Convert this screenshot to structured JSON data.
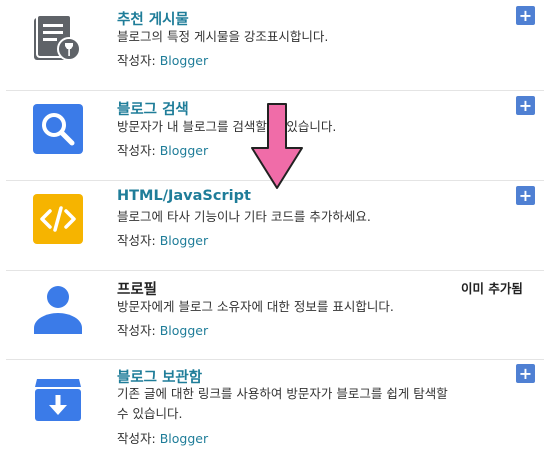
{
  "gadgets": [
    {
      "title": "추천 게시물",
      "description": "블로그의 특정 게시물을 강조표시합니다.",
      "author_label": "작성자:",
      "author": "Blogger",
      "icon": "featured-post-icon",
      "action": "+"
    },
    {
      "title": "블로그 검색",
      "description": "방문자가 내 블로그를 검색할 수 있습니다.",
      "author_label": "작성자:",
      "author": "Blogger",
      "icon": "search-icon",
      "action": "+"
    },
    {
      "title": "HTML/JavaScript",
      "description": "블로그에 타사 기능이나 기타 코드를 추가하세요.",
      "author_label": "작성자:",
      "author": "Blogger",
      "icon": "code-icon",
      "action": "+"
    },
    {
      "title": "프로필",
      "description": "방문자에게 블로그 소유자에 대한 정보를 표시합니다.",
      "author_label": "작성자:",
      "author": "Blogger",
      "icon": "person-icon",
      "status": "이미 추가됨"
    },
    {
      "title": "블로그 보관함",
      "description_line1": "기존 글에 대한 링크를 사용하여 방문자가 블로그를 쉽게 탐색할",
      "description_line2": "수 있습니다.",
      "author_label": "작성자:",
      "author": "Blogger",
      "icon": "archive-icon",
      "action": "+"
    }
  ],
  "colors": {
    "title_link": "#1f7d99",
    "plus_button": "#4f80d3",
    "icon_blue": "#3b7be8",
    "icon_gray": "#5f6368",
    "icon_yellow": "#f6b400",
    "arrow_pink": "#f06ca8"
  }
}
